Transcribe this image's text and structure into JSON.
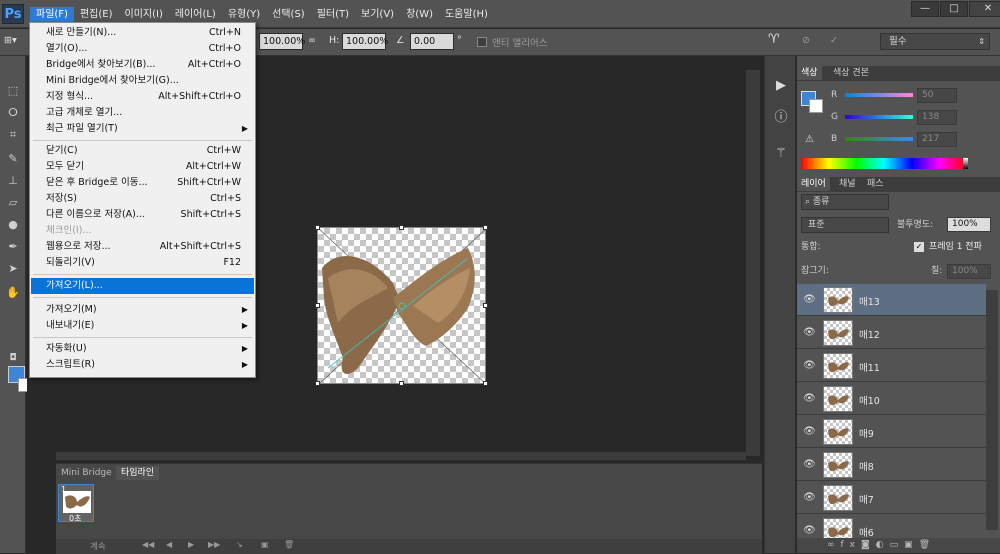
{
  "app_logo": "Ps",
  "menubar": {
    "items": [
      "파일(F)",
      "편집(E)",
      "이미지(I)",
      "레이어(L)",
      "유형(Y)",
      "선택(S)",
      "필터(T)",
      "보기(V)",
      "창(W)",
      "도움말(H)"
    ],
    "active_index": 0
  },
  "window_buttons": [
    "—",
    "□",
    "✕"
  ],
  "options_bar": {
    "w_percent": "100.00%",
    "h_label": "H:",
    "h_percent": "100.00%",
    "angle": "0.00",
    "degree": "°",
    "antialias_label": "앤티 앨리어스",
    "right_dropdown": "필수"
  },
  "file_menu": {
    "items": [
      {
        "label": "새로 만들기(N)...",
        "shortcut": "Ctrl+N"
      },
      {
        "label": "열기(O)...",
        "shortcut": "Ctrl+O"
      },
      {
        "label": "Bridge에서 찾아보기(B)...",
        "shortcut": "Alt+Ctrl+O"
      },
      {
        "label": "Mini Bridge에서 찾아보기(G)...",
        "shortcut": ""
      },
      {
        "label": "지정 형식...",
        "shortcut": "Alt+Shift+Ctrl+O"
      },
      {
        "label": "고급 개체로 열기...",
        "shortcut": ""
      },
      {
        "label": "최근 파일 열기(T)",
        "shortcut": "",
        "submenu": true
      },
      {
        "label": "닫기(C)",
        "shortcut": "Ctrl+W"
      },
      {
        "label": "모두 닫기",
        "shortcut": "Alt+Ctrl+W"
      },
      {
        "label": "닫은 후 Bridge로 이동...",
        "shortcut": "Shift+Ctrl+W"
      },
      {
        "label": "저장(S)",
        "shortcut": "Ctrl+S"
      },
      {
        "label": "다른 이름으로 저장(A)...",
        "shortcut": "Shift+Ctrl+S"
      },
      {
        "label": "체크인(I)...",
        "shortcut": "",
        "disabled": true
      },
      {
        "label": "웹용으로 저장...",
        "shortcut": "Alt+Shift+Ctrl+S"
      },
      {
        "label": "되돌리기(V)",
        "shortcut": "F12"
      },
      {
        "label": "가져오기(L)...",
        "shortcut": "",
        "highlighted": true
      },
      {
        "label": "가져오기(M)",
        "shortcut": "",
        "submenu": true
      },
      {
        "label": "내보내기(E)",
        "shortcut": "",
        "submenu": true
      },
      {
        "label": "자동화(U)",
        "shortcut": "",
        "submenu": true
      },
      {
        "label": "스크립트(R)",
        "shortcut": "",
        "submenu": true
      }
    ]
  },
  "color_panel": {
    "tabs": [
      "색상",
      "색상 견본"
    ],
    "r_label": "R",
    "r_value": "50",
    "g_label": "G",
    "g_value": "138",
    "b_label": "B",
    "b_value": "217",
    "foreground": "#3d85d8"
  },
  "layers_panel": {
    "tabs": [
      "레이어",
      "채널",
      "패스"
    ],
    "filter_label": "종류",
    "blend_mode": "표준",
    "opacity_label": "불투명도:",
    "opacity_value": "100%",
    "unify_label": "통합:",
    "propagate_label": "프레임 1 전파",
    "lock_label": "잠그기:",
    "fill_label": "칠:",
    "fill_value": "100%",
    "layers": [
      {
        "name": "매13",
        "selected": true
      },
      {
        "name": "매12"
      },
      {
        "name": "매11"
      },
      {
        "name": "매10"
      },
      {
        "name": "매9"
      },
      {
        "name": "매8"
      },
      {
        "name": "매7"
      },
      {
        "name": "매6"
      }
    ]
  },
  "timeline": {
    "tabs": [
      "Mini Bridge",
      "타임라인"
    ],
    "active_tab": 1,
    "frame_number": "1",
    "frame_delay": "0초",
    "loop_label": "계속"
  }
}
